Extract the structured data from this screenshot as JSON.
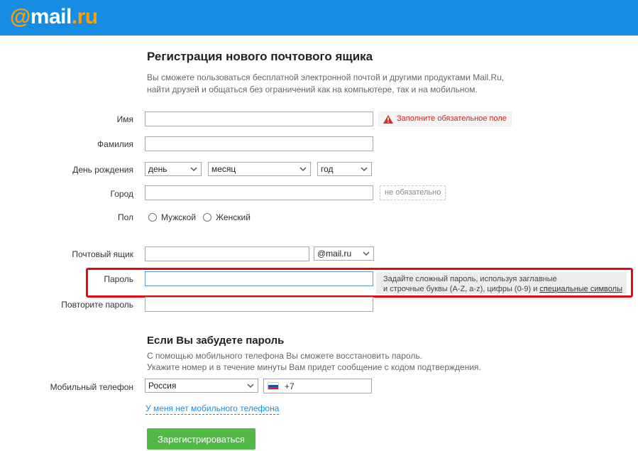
{
  "brand": {
    "at": "@",
    "mail": "mail",
    "ru": ".ru"
  },
  "form": {
    "title": "Регистрация нового почтового ящика",
    "subtitle_line1": "Вы сможете пользоваться бесплатной электронной почтой и другими продуктами Mail.Ru,",
    "subtitle_line2": "найти друзей и общаться без ограничений как на компьютере, так и на мобильном.",
    "name_label": "Имя",
    "name_error": "Заполните обязательное поле",
    "surname_label": "Фамилия",
    "birthday_label": "День рождения",
    "day_value": "день",
    "month_value": "месяц",
    "year_value": "год",
    "city_label": "Город",
    "city_hint": "не обязательно",
    "gender_label": "Пол",
    "gender_male": "Мужской",
    "gender_female": "Женский",
    "mailbox_label": "Почтовый ящик",
    "domain_value": "@mail.ru",
    "password_label": "Пароль",
    "password_hint_line1": "Задайте сложный пароль, используя заглавные",
    "password_hint_line2": "и строчные буквы (A-Z, a-z), цифры (0-9) и ",
    "password_hint_link": "специальные символы",
    "repeat_password_label": "Повторите пароль"
  },
  "recovery": {
    "title": "Если Вы забудете пароль",
    "text_line1": "С помощью мобильного телефона Вы сможете восстановить пароль.",
    "text_line2": "Укажите номер и в течение минуты Вам придет сообщение с кодом подтверждения.",
    "phone_label": "Мобильный телефон",
    "country_value": "Россия",
    "phone_prefix": "+7",
    "no_phone_link": "У меня нет мобильного телефона",
    "register_button": "Зарегистрироваться"
  },
  "colors": {
    "header": "#168de2",
    "logo_accent": "#ff9e00",
    "error": "#c8231d",
    "highlight_frame": "#e20a16",
    "register_button": "#52b947"
  }
}
